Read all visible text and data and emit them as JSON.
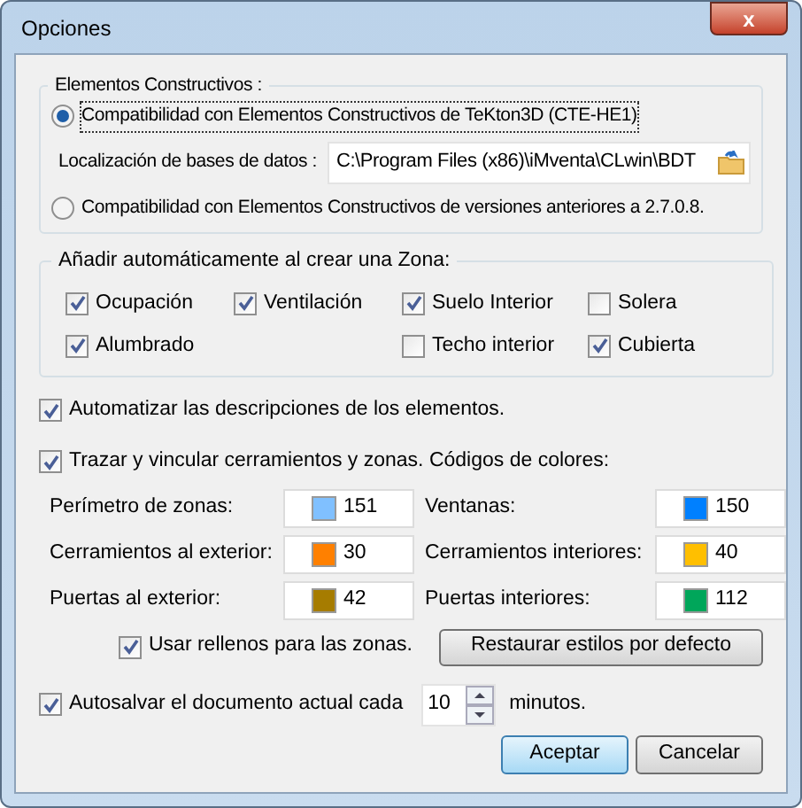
{
  "window": {
    "title": "Opciones",
    "close": "x"
  },
  "elements_group": {
    "title": "Elementos Constructivos :",
    "options": [
      {
        "label": "Compatibilidad con Elementos Constructivos de TeKton3D (CTE-HE1)",
        "selected": true
      },
      {
        "label": "Compatibilidad con Elementos Constructivos de versiones anteriores a 2.7.0.8.",
        "selected": false
      }
    ],
    "database": {
      "label": "Localización de bases de datos :",
      "value": "C:\\Program Files (x86)\\iMventa\\CLwin\\BDT"
    }
  },
  "zone_group": {
    "title": "Añadir automáticamente al crear una Zona:",
    "columns": [
      [
        {
          "label": "Ocupación",
          "checked": true
        },
        {
          "label": "Alumbrado",
          "checked": true
        }
      ],
      [
        {
          "label": "Ventilación",
          "checked": true
        }
      ],
      [
        {
          "label": "Suelo Interior",
          "checked": true
        },
        {
          "label": "Techo interior",
          "checked": false
        }
      ],
      [
        {
          "label": "Solera",
          "checked": false
        },
        {
          "label": "Cubierta",
          "checked": true
        }
      ]
    ]
  },
  "automate": {
    "label": "Automatizar las descripciones de los elementos.",
    "checked": true
  },
  "trace": {
    "label": "Trazar y vincular cerramientos y zonas. Códigos de colores:",
    "checked": true
  },
  "colors": [
    {
      "label": "Perímetro de zonas:",
      "value": "151",
      "color": "#80c0ff"
    },
    {
      "label": "Ventanas:",
      "value": "150",
      "color": "#0080ff"
    },
    {
      "label": "Cerramientos al exterior:",
      "value": "30",
      "color": "#ff8000"
    },
    {
      "label": "Cerramientos interiores:",
      "value": "40",
      "color": "#ffbf00"
    },
    {
      "label": "Puertas al exterior:",
      "value": "42",
      "color": "#a67c00"
    },
    {
      "label": "Puertas interiores:",
      "value": "112",
      "color": "#00a65a"
    }
  ],
  "fills": {
    "label": "Usar rellenos para las zonas.",
    "checked": true
  },
  "restore_button": "Restaurar estilos por defecto",
  "autosave": {
    "label": "Autosalvar el documento actual cada",
    "checked": true,
    "value": "10",
    "suffix": "minutos."
  },
  "buttons": [
    {
      "label": "Aceptar",
      "default": true
    },
    {
      "label": "Cancelar",
      "default": false
    }
  ]
}
